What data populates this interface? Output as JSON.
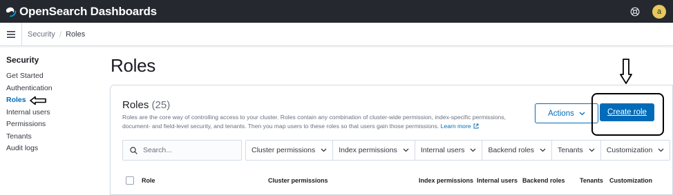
{
  "app": {
    "brand_name": "OpenSearch Dashboards",
    "user_initial": "a"
  },
  "breadcrumb": {
    "items": [
      "Security",
      "Roles"
    ]
  },
  "sidebar": {
    "title": "Security",
    "items": [
      {
        "label": "Get Started",
        "active": false
      },
      {
        "label": "Authentication",
        "active": false
      },
      {
        "label": "Roles",
        "active": true
      },
      {
        "label": "Internal users",
        "active": false
      },
      {
        "label": "Permissions",
        "active": false
      },
      {
        "label": "Tenants",
        "active": false
      },
      {
        "label": "Audit logs",
        "active": false
      }
    ]
  },
  "page": {
    "title": "Roles"
  },
  "panel": {
    "title": "Roles",
    "count": "(25)",
    "description": "Roles are the core way of controlling access to your cluster. Roles contain any combination of cluster-wide permission, index-specific permissions, document- and field-level security, and tenants. Then you map users to these roles so that users gain those permissions.",
    "learn_more": "Learn more",
    "actions_label": "Actions",
    "create_label": "Create role",
    "search_placeholder": "Search...",
    "filters": [
      "Cluster permissions",
      "Index permissions",
      "Internal users",
      "Backend roles",
      "Tenants",
      "Customization"
    ],
    "columns": [
      "Role",
      "Cluster permissions",
      "Index permissions",
      "Internal users",
      "Backend roles",
      "Tenants",
      "Customization"
    ]
  },
  "colors": {
    "header_bg": "#25282f",
    "accent": "#006bb8",
    "avatar": "#e7c85a"
  }
}
